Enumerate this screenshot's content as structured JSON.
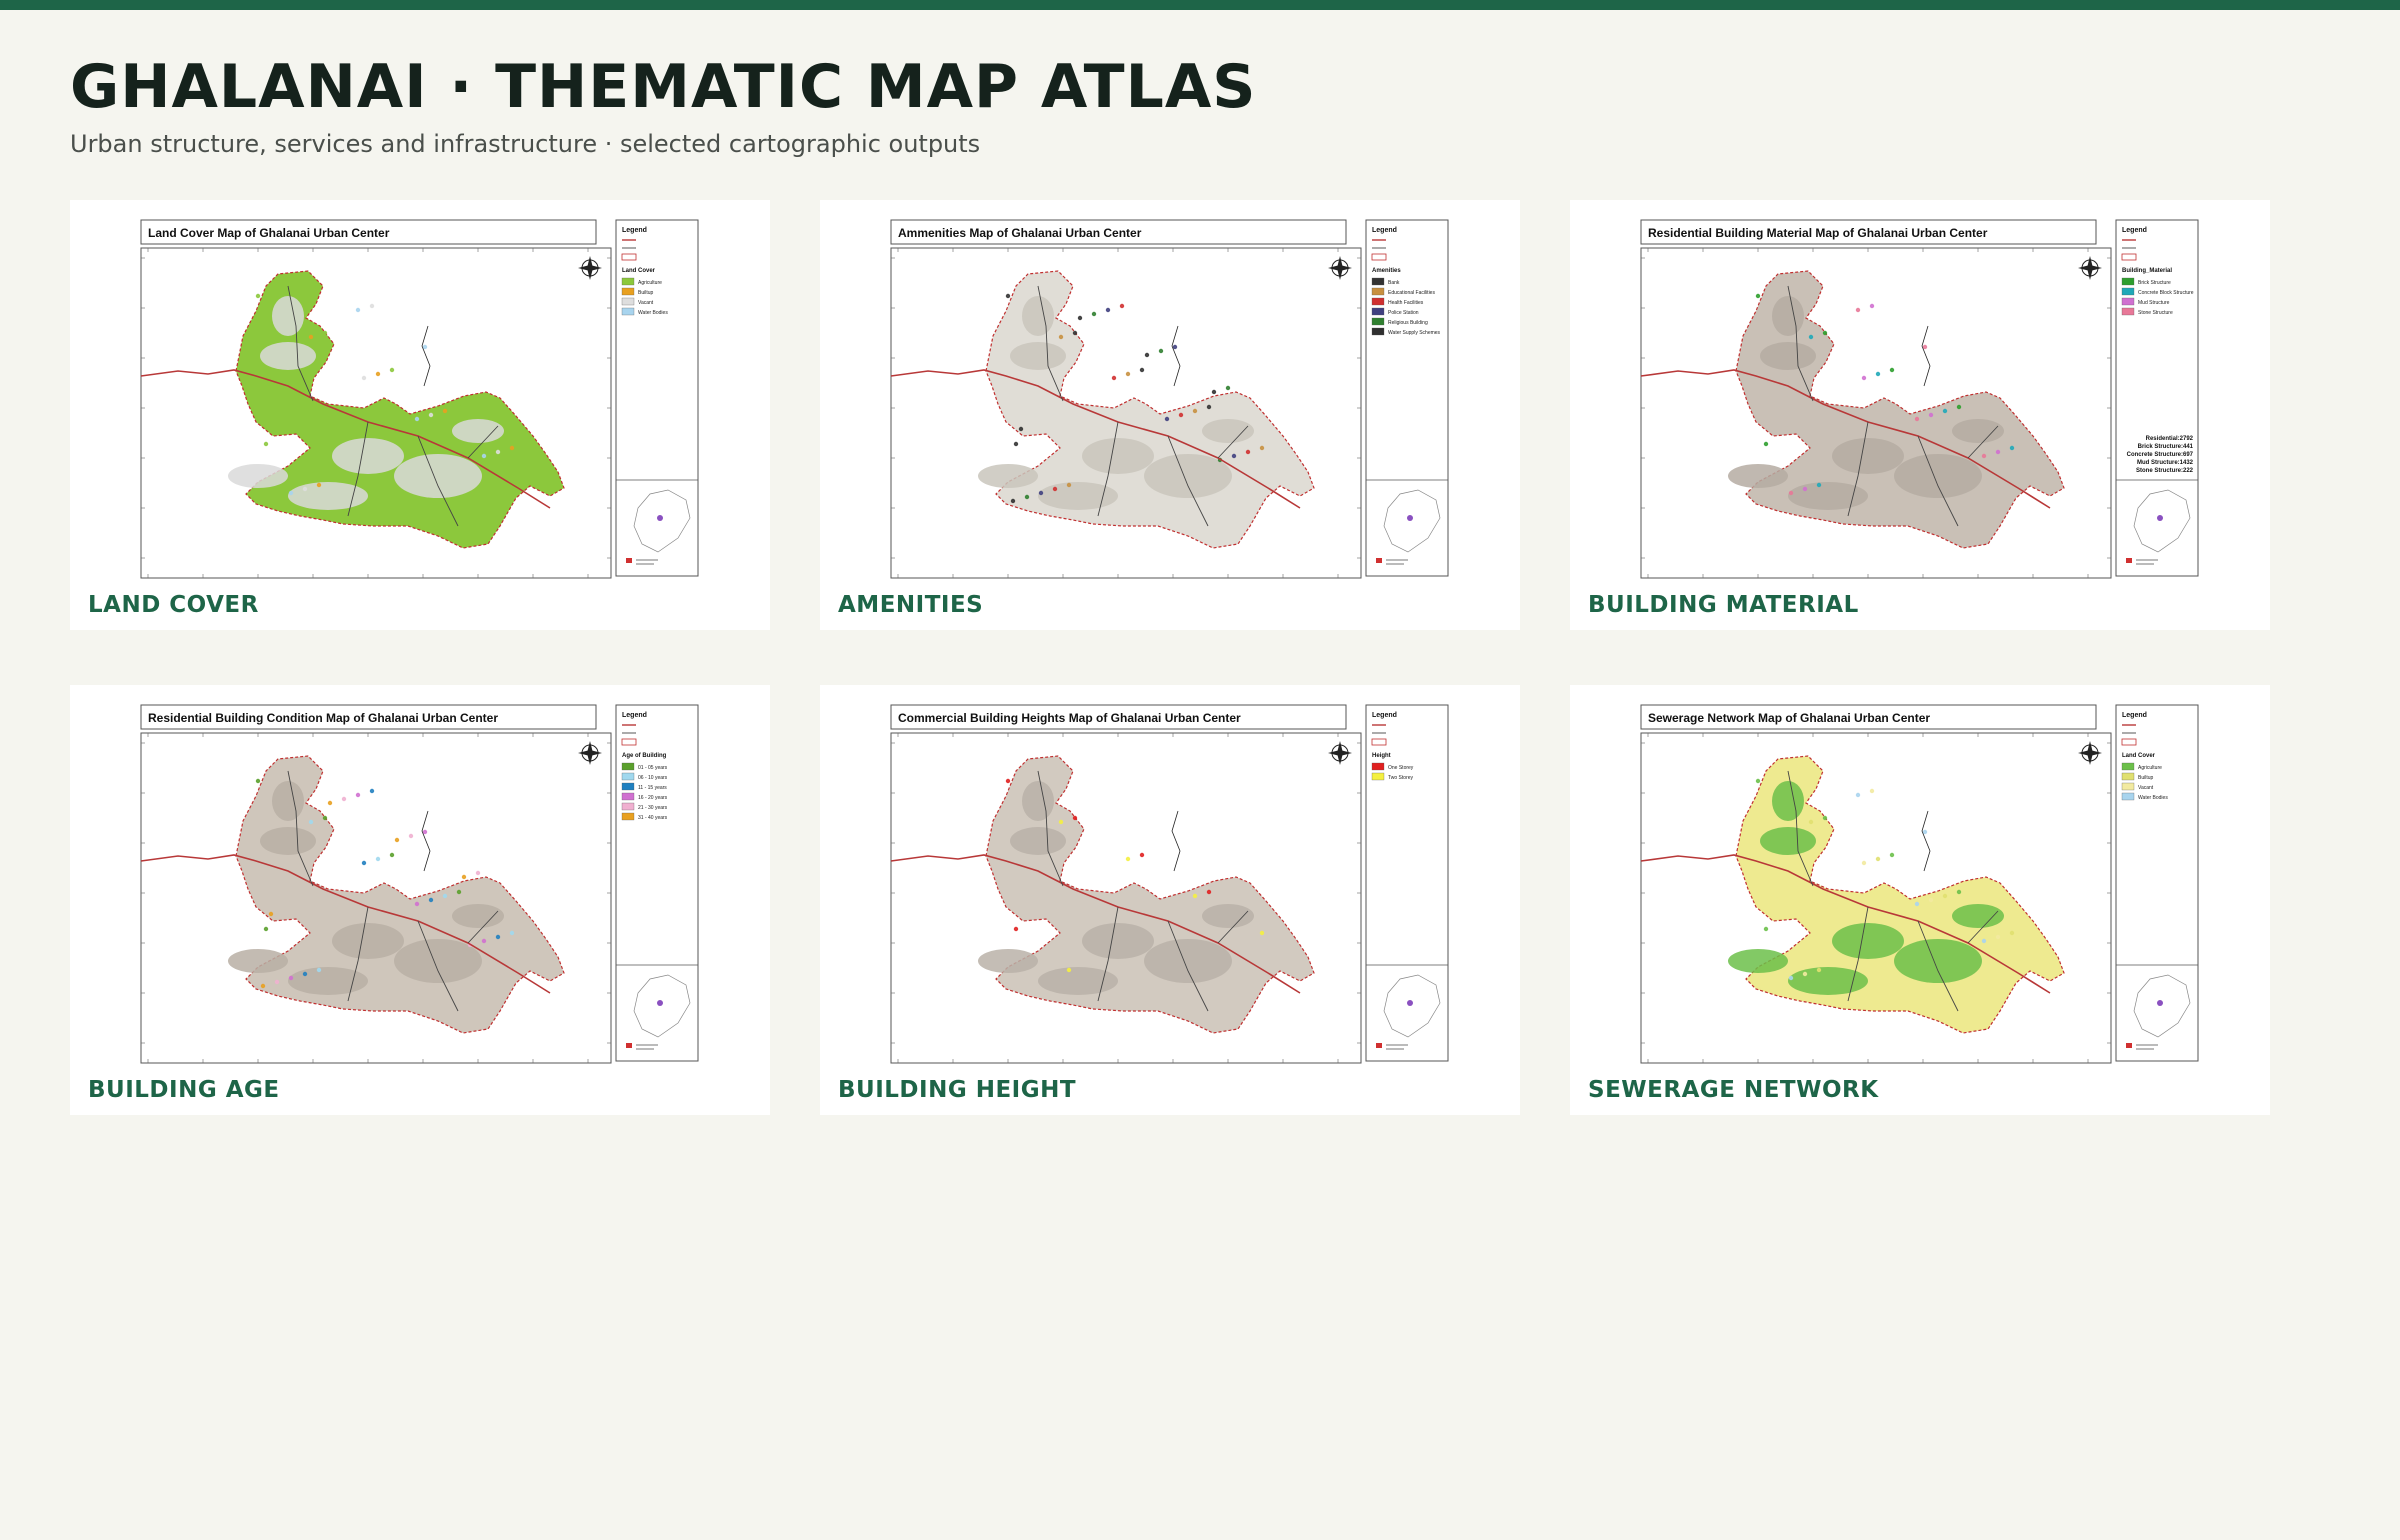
{
  "page": {
    "title": "GHALANAI · THEMATIC MAP ATLAS",
    "subtitle": "Urban structure, services and infrastructure · selected cartographic outputs",
    "accent_color": "#1e6548"
  },
  "maps": [
    {
      "caption": "LAND COVER",
      "map_title": "Land Cover Map of Ghalanai Urban Center",
      "legend_heading": "Legend",
      "legend_section": "Land Cover",
      "legend_items": [
        {
          "label": "Agriculture",
          "color": "#8cc83c"
        },
        {
          "label": "Builtup",
          "color": "#e8a020"
        },
        {
          "label": "Vacant",
          "color": "#dedede"
        },
        {
          "label": "Water Bodies",
          "color": "#a8d4ee"
        }
      ],
      "fill_color": "#8cc83c",
      "secondary_color": "#d9d9d9"
    },
    {
      "caption": "AMENITIES",
      "map_title": "Ammenities Map of Ghalanai Urban Center",
      "legend_heading": "Legend",
      "legend_section": "Amenities",
      "legend_items": [
        {
          "label": "Bank",
          "color": "#333333"
        },
        {
          "label": "Educational Facilities",
          "color": "#c89040"
        },
        {
          "label": "Health Facilities",
          "color": "#d03030"
        },
        {
          "label": "Police Station",
          "color": "#404080"
        },
        {
          "label": "Religious Building",
          "color": "#308030"
        },
        {
          "label": "Water Supply Schemes",
          "color": "#303030"
        }
      ],
      "fill_color": "#e0ddd6",
      "secondary_color": "#c9c5bc"
    },
    {
      "caption": "BUILDING MATERIAL",
      "map_title": "Residential Building Material Map of Ghalanai Urban Center",
      "legend_heading": "Legend",
      "legend_section": "Building_Material",
      "legend_items": [
        {
          "label": "Brick Structure",
          "color": "#2e9e2e"
        },
        {
          "label": "Concrete Block Structure",
          "color": "#20a8b8"
        },
        {
          "label": "Mud Structure",
          "color": "#d070d0"
        },
        {
          "label": "Stone Structure",
          "color": "#e87898"
        }
      ],
      "stats": [
        "Residential:2792",
        "Brick Structure:441",
        "Concrete Structure:697",
        "Mud Structure:1432",
        "Stone Structure:222"
      ],
      "fill_color": "#c9c0b6",
      "secondary_color": "#b5aca2"
    },
    {
      "caption": "BUILDING AGE",
      "map_title": "Residential Building Condition Map of Ghalanai Urban Center",
      "legend_heading": "Legend",
      "legend_section": "Age of Building",
      "legend_items": [
        {
          "label": "01 - 05 years",
          "color": "#5aa02c"
        },
        {
          "label": "06 - 10 years",
          "color": "#a0d8ee"
        },
        {
          "label": "11 - 15 years",
          "color": "#2080c0"
        },
        {
          "label": "16 - 20 years",
          "color": "#d070d0"
        },
        {
          "label": "21 - 30 years",
          "color": "#f0b0d0"
        },
        {
          "label": "31 - 40 years",
          "color": "#e8a020"
        }
      ],
      "fill_color": "#cfc6bb",
      "secondary_color": "#b8afa5"
    },
    {
      "caption": "BUILDING HEIGHT",
      "map_title": "Commercial Building Heights Map of Ghalanai Urban Center",
      "legend_heading": "Legend",
      "legend_section": "Height",
      "legend_items": [
        {
          "label": "One Storey",
          "color": "#e02020"
        },
        {
          "label": "Two Storey",
          "color": "#f4f040"
        }
      ],
      "fill_color": "#d2cac0",
      "secondary_color": "#bab2a8"
    },
    {
      "caption": "SEWERAGE NETWORK",
      "map_title": "Sewerage Network Map of Ghalanai Urban Center",
      "legend_heading": "Legend",
      "legend_section": "Land Cover",
      "legend_items": [
        {
          "label": "Agriculture",
          "color": "#6cc04a"
        },
        {
          "label": "Builtup",
          "color": "#e0e070"
        },
        {
          "label": "Vacant",
          "color": "#f2eaa0"
        },
        {
          "label": "Water Bodies",
          "color": "#a8d4ee"
        }
      ],
      "fill_color": "#eeea90",
      "secondary_color": "#6cc04a"
    }
  ]
}
